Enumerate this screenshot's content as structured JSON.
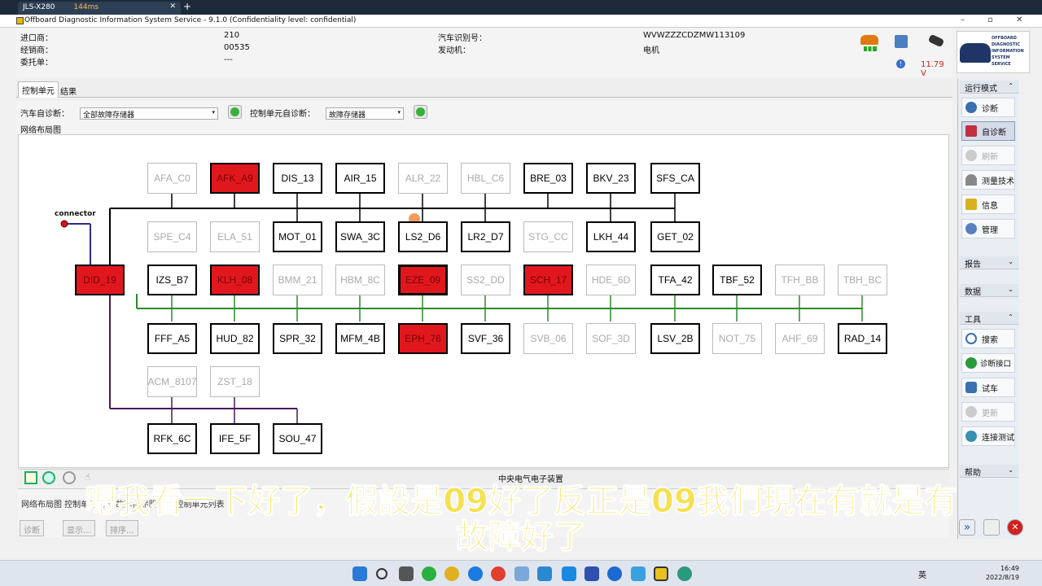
{
  "browser": {
    "tab_title": "JLS-X280",
    "latency": "144ms"
  },
  "window": {
    "title": "Offboard Diagnostic Information System Service - 9.1.0 (Confidentiality level: confidential)"
  },
  "info": {
    "importer_label": "进口商：",
    "importer_value": "210",
    "dealer_label": "经销商：",
    "dealer_value": "00535",
    "client_label": "委托单：",
    "client_value": "---",
    "vin_label": "汽车识别号：",
    "vin_value": "WVWZZZCDZMW113109",
    "engine_label": "发动机：",
    "engine_value": "电机"
  },
  "status": {
    "voltage": "11.79 V"
  },
  "logo": {
    "line1": "OFFBOARD",
    "line2": "DIAGNOSTIC",
    "line3": "INFORMATION",
    "line4": "SYSTEM",
    "line5": "SERVICE"
  },
  "tabs": [
    {
      "label": "控制单元"
    },
    {
      "label": "结果"
    }
  ],
  "toolbar": {
    "vehicle_selfdiag_label": "汽车自诊断：",
    "vehicle_selfdiag_value": "全部故障存储器",
    "cu_selfdiag_label": "控制单元自诊断：",
    "cu_selfdiag_value": "故障存储器",
    "network_label": "网络布局图"
  },
  "network": {
    "connector_label": "connector",
    "nodes": [
      {
        "id": "AFA_C0",
        "state": "dim"
      },
      {
        "id": "AFK_A9",
        "state": "fault"
      },
      {
        "id": "DIS_13",
        "state": "normal"
      },
      {
        "id": "AIR_15",
        "state": "normal"
      },
      {
        "id": "ALR_22",
        "state": "dim"
      },
      {
        "id": "HBL_C6",
        "state": "dim"
      },
      {
        "id": "BRE_03",
        "state": "normal"
      },
      {
        "id": "BKV_23",
        "state": "normal"
      },
      {
        "id": "SFS_CA",
        "state": "normal"
      },
      {
        "id": "SPE_C4",
        "state": "dim"
      },
      {
        "id": "ELA_51",
        "state": "dim"
      },
      {
        "id": "MOT_01",
        "state": "normal"
      },
      {
        "id": "SWA_3C",
        "state": "normal"
      },
      {
        "id": "LS2_D6",
        "state": "normal"
      },
      {
        "id": "LR2_D7",
        "state": "normal"
      },
      {
        "id": "STG_CC",
        "state": "dim"
      },
      {
        "id": "LKH_44",
        "state": "normal"
      },
      {
        "id": "GET_02",
        "state": "normal"
      },
      {
        "id": "DID_19",
        "state": "fault"
      },
      {
        "id": "IZS_B7",
        "state": "normal"
      },
      {
        "id": "KLH_08",
        "state": "fault"
      },
      {
        "id": "BMM_21",
        "state": "dim"
      },
      {
        "id": "HBM_8C",
        "state": "dim"
      },
      {
        "id": "EZE_09",
        "state": "fault-selected"
      },
      {
        "id": "SS2_DD",
        "state": "dim"
      },
      {
        "id": "SCH_17",
        "state": "fault"
      },
      {
        "id": "HDE_6D",
        "state": "dim"
      },
      {
        "id": "TFA_42",
        "state": "normal"
      },
      {
        "id": "TBF_52",
        "state": "normal"
      },
      {
        "id": "TFH_BB",
        "state": "dim"
      },
      {
        "id": "TBH_BC",
        "state": "dim"
      },
      {
        "id": "FFF_A5",
        "state": "normal"
      },
      {
        "id": "HUD_82",
        "state": "normal"
      },
      {
        "id": "SPR_32",
        "state": "normal"
      },
      {
        "id": "MFM_4B",
        "state": "normal"
      },
      {
        "id": "EPH_76",
        "state": "fault"
      },
      {
        "id": "SVF_36",
        "state": "normal"
      },
      {
        "id": "SVB_06",
        "state": "dim"
      },
      {
        "id": "SOF_3D",
        "state": "dim"
      },
      {
        "id": "LSV_2B",
        "state": "normal"
      },
      {
        "id": "NOT_75",
        "state": "dim"
      },
      {
        "id": "AHF_69",
        "state": "dim"
      },
      {
        "id": "RAD_14",
        "state": "normal"
      },
      {
        "id": "ACM_8107",
        "state": "dim"
      },
      {
        "id": "ZST_18",
        "state": "dim"
      },
      {
        "id": "RFK_6C",
        "state": "normal"
      },
      {
        "id": "IFE_5F",
        "state": "normal"
      },
      {
        "id": "SOU_47",
        "state": "normal"
      }
    ]
  },
  "bottom": {
    "title": "中央电气电子装置"
  },
  "lower": {
    "tabs_text": "网络布局图   控制单元列表   故障存储器列表   控制单元列表",
    "btn_diag": "诊断",
    "btn_show": "显示...",
    "btn_sort": "排序..."
  },
  "sidebar": {
    "run_mode": "运行模式",
    "items": [
      {
        "label": "诊断",
        "state": "normal"
      },
      {
        "label": "自诊断",
        "state": "active"
      },
      {
        "label": "刷新",
        "state": "disabled"
      },
      {
        "label": "测量技术",
        "state": "normal"
      },
      {
        "label": "信息",
        "state": "normal"
      },
      {
        "label": "管理",
        "state": "normal"
      }
    ],
    "report": "报告",
    "data": "数据",
    "tools": "工具",
    "tool_items": [
      {
        "label": "搜索",
        "state": "normal"
      },
      {
        "label": "诊断接口",
        "state": "normal"
      },
      {
        "label": "试车",
        "state": "normal"
      },
      {
        "label": "更新",
        "state": "disabled"
      },
      {
        "label": "连接测试",
        "state": "normal"
      }
    ],
    "help": "帮助"
  },
  "subtitle": {
    "line1": "嗯我看一下好了，假設是09好了反正是09我們現在有就是有",
    "line2": "故障好了"
  },
  "taskbar": {
    "lang": "英",
    "time": "16:49",
    "date": "2022/8/19"
  }
}
